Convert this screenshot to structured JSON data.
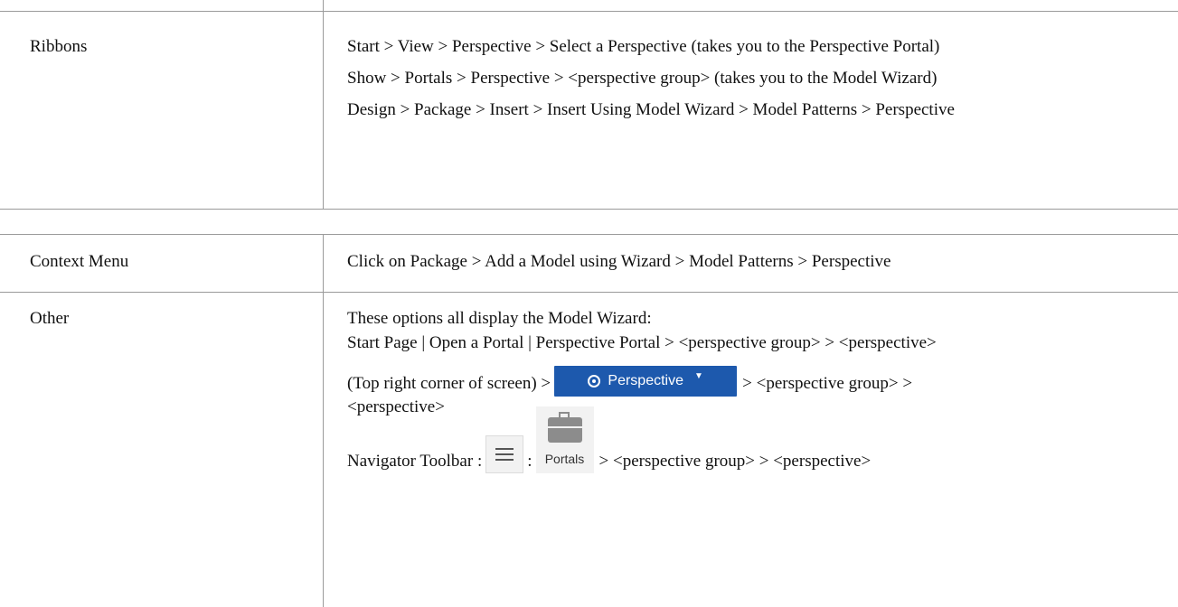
{
  "rows": [
    {
      "label": "Ribbons",
      "paragraphs": [
        "Start > View > Perspective > Select a Perspective (takes you to the Perspective Portal)",
        "Show > Portals > Perspective > <perspective group> (takes you to the Model Wizard)",
        "Design > Package > Insert > Insert Using Model Wizard > Model Patterns > Perspective"
      ]
    },
    {
      "label": "Context Menu",
      "paragraphs": [
        "Click on Package > Add a Model using Wizard > Model Patterns > Perspective"
      ]
    },
    {
      "label": "Other",
      "intro": "These options all display the Model Wizard:",
      "start_page": "Start Page | Open a Portal | Perspective Portal > <perspective group> > <perspective>",
      "top_right_prefix": "(Top right corner of screen) >",
      "top_right_suffix": "> <perspective group> >",
      "top_right_line2": "<perspective>",
      "perspective_button_label": "Perspective",
      "navigator_prefix": "Navigator Toolbar :",
      "navigator_sep": ":",
      "portals_label": "Portals",
      "navigator_suffix": "> <perspective group> > <perspective>"
    }
  ],
  "icons": {
    "perspective_button": "eye-icon",
    "perspective_dropdown": "caret-down-icon",
    "menu_button": "hamburger-menu-icon",
    "portals_button": "briefcase-icon"
  },
  "colors": {
    "perspective_button_bg": "#1d59ad",
    "toolbar_button_bg": "#f2f2f2",
    "grid_line": "#9a9a9a"
  }
}
